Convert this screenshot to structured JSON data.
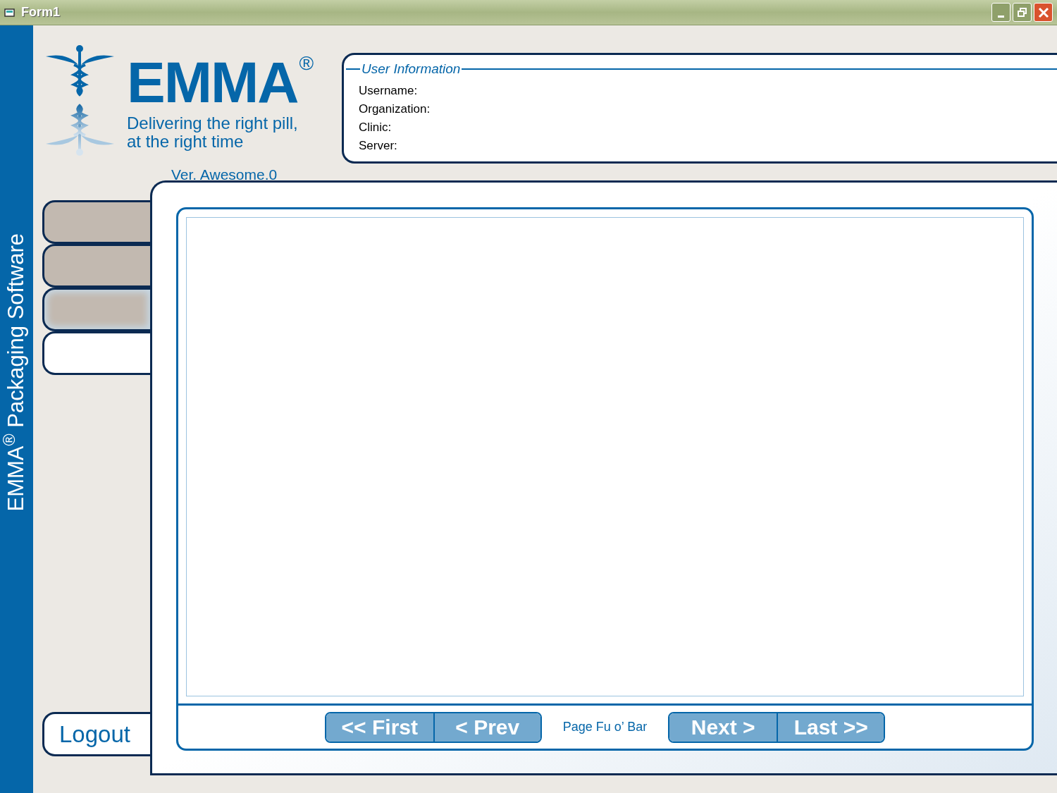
{
  "window": {
    "title": "Form1"
  },
  "sidebar_caption": "EMMA$^{®}$ Packaging Software",
  "logo": {
    "wordmark": "EMMA",
    "registered": "®",
    "tagline_lines": [
      "Delivering the right pill,",
      "at the right time"
    ]
  },
  "version": "Ver. Awesome.0",
  "user_information": {
    "title": "User Information",
    "fields": [
      "Username:",
      "Organization:",
      "Clinic:",
      "Server:"
    ]
  },
  "tabs": [
    {
      "selected": false,
      "hovered": false
    },
    {
      "selected": false,
      "hovered": false
    },
    {
      "selected": false,
      "hovered": true
    },
    {
      "selected": true,
      "hovered": false
    }
  ],
  "logout": "Logout",
  "pager": {
    "left_buttons": [
      "<< First",
      "< Prev"
    ],
    "page_label": "Page Fu o’ Bar",
    "right_buttons": [
      "Next >",
      "Last >>"
    ]
  }
}
